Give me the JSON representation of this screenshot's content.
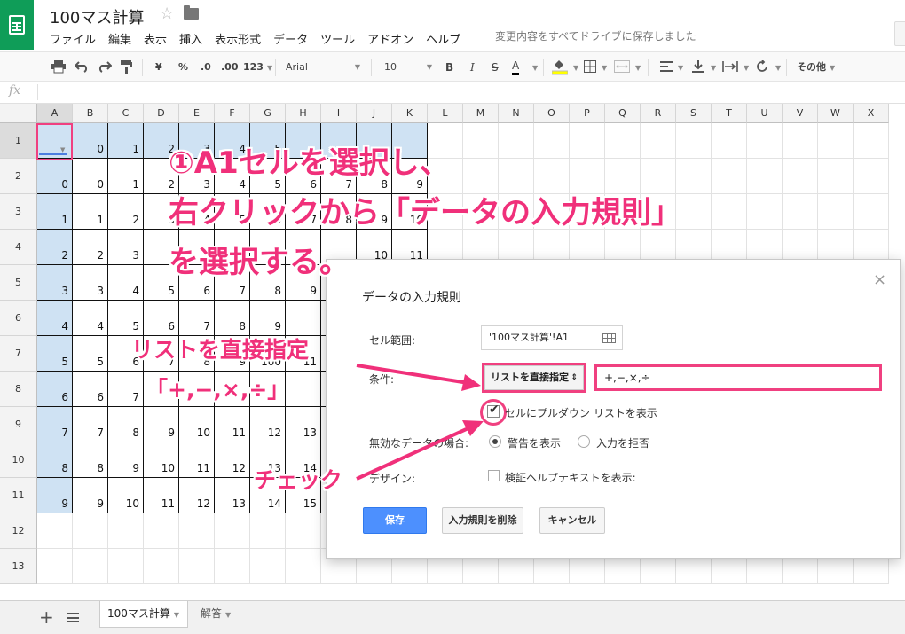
{
  "app": {
    "doc_title": "100マス計算",
    "save_status": "変更内容をすべてドライブに保存しました"
  },
  "menu": [
    "ファイル",
    "編集",
    "表示",
    "挿入",
    "表示形式",
    "データ",
    "ツール",
    "アドオン",
    "ヘルプ"
  ],
  "toolbar": {
    "currency": "¥",
    "percent": "%",
    "dec_decrease": ".0",
    "dec_increase": ".00",
    "more_formats": "123",
    "font": "Arial",
    "font_size": "10",
    "bold": "B",
    "italic": "I",
    "strike": "S",
    "text_color": "A",
    "more": "その他"
  },
  "formula_bar": {
    "fx": "fx"
  },
  "columns": [
    "A",
    "B",
    "C",
    "D",
    "E",
    "F",
    "G",
    "H",
    "I",
    "J",
    "K",
    "L",
    "M",
    "N",
    "O",
    "P",
    "Q",
    "R",
    "S",
    "T",
    "U",
    "V",
    "W",
    "X"
  ],
  "rows": [
    "1",
    "2",
    "3",
    "4",
    "5",
    "6",
    "7",
    "8",
    "9",
    "10",
    "11",
    "12",
    "13"
  ],
  "visible_cells": [
    [
      "",
      "0",
      "1",
      "2",
      "3",
      "4",
      "5",
      "",
      "",
      "",
      ""
    ],
    [
      "0",
      "0",
      "1",
      "2",
      "3",
      "4",
      "5",
      "6",
      "7",
      "8",
      "9"
    ],
    [
      "1",
      "1",
      "2",
      "3",
      "4",
      "5",
      "6",
      "7",
      "8",
      "9",
      "10"
    ],
    [
      "2",
      "2",
      "3",
      "",
      "",
      "",
      "",
      "",
      "",
      "10",
      "11"
    ],
    [
      "3",
      "3",
      "4",
      "5",
      "6",
      "7",
      "8",
      "9",
      "",
      "",
      ""
    ],
    [
      "4",
      "4",
      "5",
      "6",
      "7",
      "8",
      "9",
      "",
      "",
      "",
      ""
    ],
    [
      "5",
      "5",
      "6",
      "7",
      "8",
      "9",
      "100",
      "11",
      "",
      "",
      ""
    ],
    [
      "6",
      "6",
      "7",
      "",
      "",
      "",
      "",
      "",
      "",
      "",
      ""
    ],
    [
      "7",
      "7",
      "8",
      "9",
      "10",
      "11",
      "12",
      "13",
      "",
      "",
      ""
    ],
    [
      "8",
      "8",
      "9",
      "10",
      "11",
      "12",
      "13",
      "14",
      "",
      "",
      ""
    ],
    [
      "9",
      "9",
      "10",
      "11",
      "12",
      "13",
      "14",
      "15",
      "",
      "",
      ""
    ]
  ],
  "sheets": {
    "tab1": "100マス計算",
    "tab2": "解答"
  },
  "dialog": {
    "title": "データの入力規則",
    "close": "×",
    "range_label": "セル範囲:",
    "range_value": "'100マス計算'!A1",
    "criteria_label": "条件:",
    "criteria_type": "リストを直接指定",
    "criteria_values": "+,−,×,÷",
    "show_dropdown_label": "セルにプルダウン リストを表示",
    "show_dropdown_checked": true,
    "invalid_label": "無効なデータの場合:",
    "invalid_warn": "警告を表示",
    "invalid_reject": "入力を拒否",
    "design_label": "デザイン:",
    "help_text_label": "検証ヘルプテキストを表示:",
    "save": "保存",
    "remove": "入力規則を削除",
    "cancel": "キャンセル"
  },
  "annotations": {
    "step1_line1": "①A1セルを選択し、",
    "step1_line2": "右クリックから「データの入力規則」",
    "step1_line3": "を選択する。",
    "list_line1": "リストを直接指定",
    "list_line2": "「+,−,×,÷」",
    "check": "チェック",
    "color": "#f0307a"
  }
}
